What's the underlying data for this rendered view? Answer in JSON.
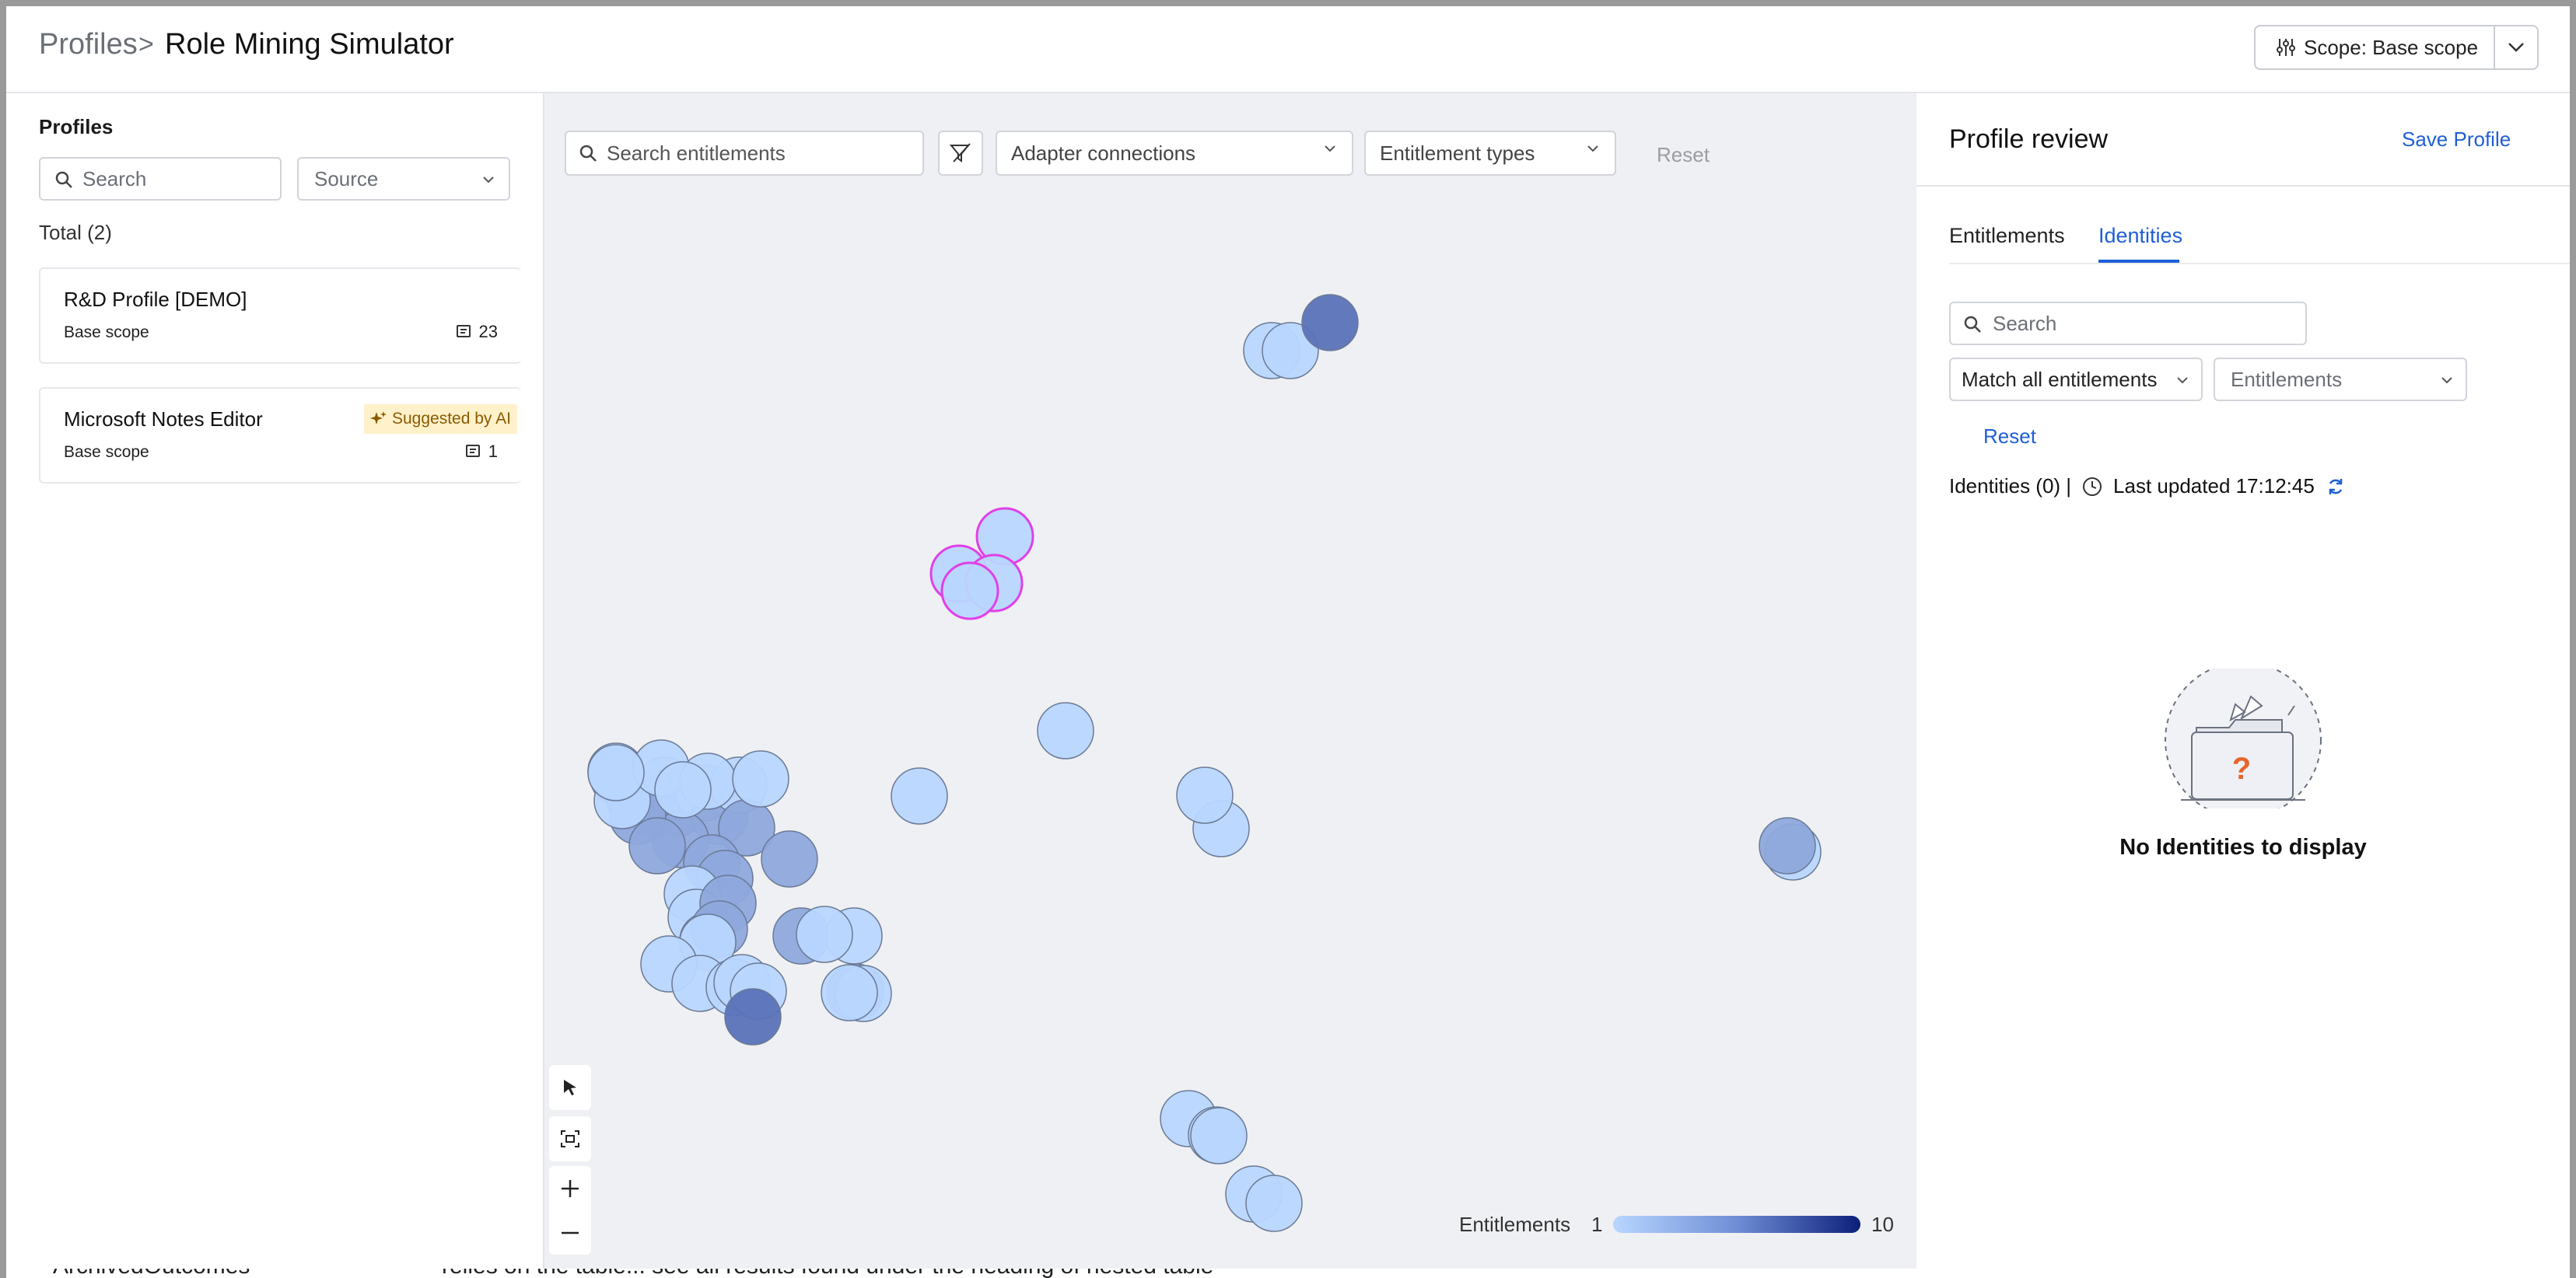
{
  "background_strip": {
    "text_left": "ArchivedOutcomes",
    "text_mid": "relies on the table... see all results found under the heading of nested table"
  },
  "header": {
    "breadcrumb": "Profiles",
    "separator": ">",
    "title": "Role Mining Simulator",
    "scope_label": "Scope: Base scope"
  },
  "profiles_panel": {
    "title": "Profiles",
    "search_placeholder": "Search",
    "source_placeholder": "Source",
    "total": "Total (2)",
    "cards": [
      {
        "name": "R&D Profile [DEMO]",
        "scope": "Base scope",
        "count": "23",
        "badge": ""
      },
      {
        "name": "Microsoft Notes Editor",
        "scope": "Base scope",
        "count": "1",
        "badge": "Suggested by AI"
      }
    ]
  },
  "canvas": {
    "search_placeholder": "Search entitlements",
    "adapter_placeholder": "Adapter connections",
    "types_placeholder": "Entitlement types",
    "reset_label": "Reset",
    "legend": {
      "label": "Entitlements",
      "min": "1",
      "max": "10"
    }
  },
  "review_panel": {
    "title": "Profile review",
    "save_label": "Save Profile",
    "tabs": [
      {
        "label": "Entitlements",
        "active": false
      },
      {
        "label": "Identities",
        "active": true
      }
    ],
    "search_placeholder": "Search",
    "match_label": "Match all entitlements",
    "entitlements_label": "Entitlements",
    "reset_label": "Reset",
    "identities_count": "Identities (0) |",
    "last_updated": "Last updated 17:12:45",
    "empty_text": "No Identities to display"
  },
  "colors": {
    "accent": "#1f5fd6",
    "node_light": "#b8d6ff",
    "node_mid": "#8ea8dc",
    "node_dark": "#5a72b8",
    "node_selected_stroke": "#e040e8",
    "ai_badge_bg": "#fff1c9"
  }
}
